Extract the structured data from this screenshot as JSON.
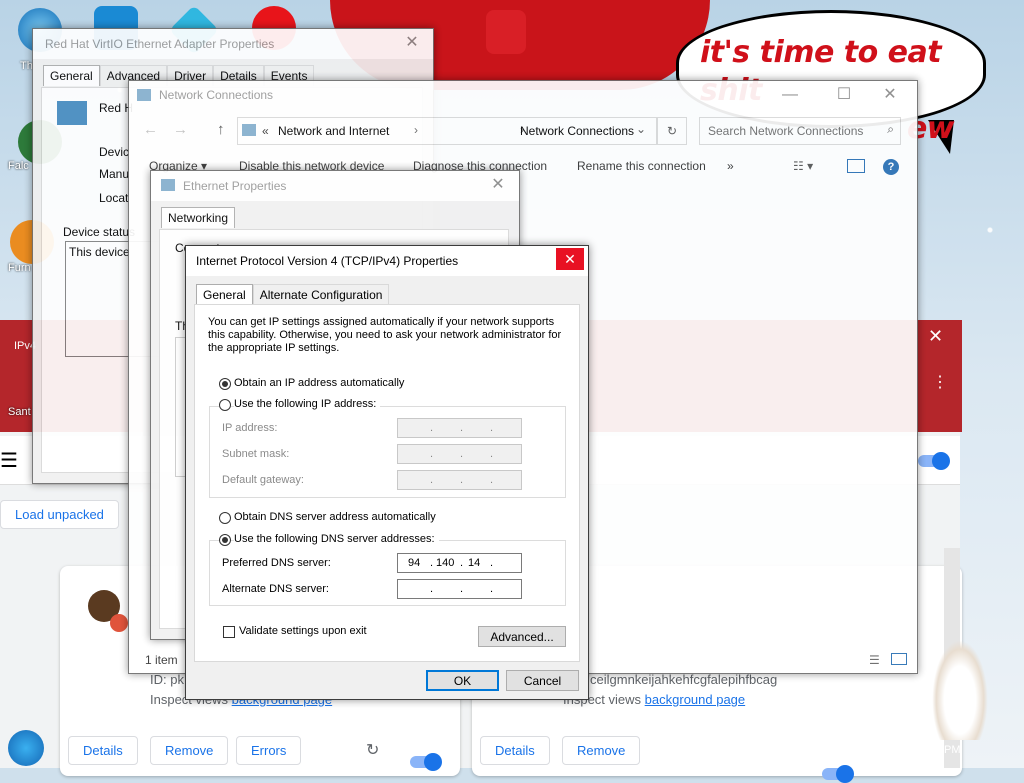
{
  "wallpaper": {
    "speech_line1": "it's time to eat shit",
    "speech_line2": "ew"
  },
  "desktop_icons": [
    {
      "label": "Th"
    },
    {
      "label": "Falc"
    },
    {
      "label": "Furn"
    },
    {
      "label": "Sant"
    }
  ],
  "extensions_page": {
    "load_unpacked": "Load unpacked",
    "id_prefix": "ID: pk",
    "id_right": "ceilgmnkeijahkehfcgfalepihfbcag",
    "inspect_left": "Inspect views",
    "inspect_left_link": "background page",
    "inspect_right": "Inspect views",
    "inspect_right_link": "background page",
    "details": "Details",
    "remove": "Remove",
    "errors": "Errors",
    "details2": "Details",
    "remove2": "Remove",
    "ipv4_fragment": "IPv4"
  },
  "adapter_window": {
    "title": "Red Hat VirtIO Ethernet Adapter Properties",
    "tabs": [
      "General",
      "Advanced",
      "Driver",
      "Details",
      "Events"
    ],
    "name_fragment": "Red H",
    "device_type_label": "Devic",
    "manufacturer_label": "Manu",
    "location_label": "Locat",
    "device_status_label": "Device status",
    "device_status_text": "This device"
  },
  "network_connections": {
    "title": "Network Connections",
    "breadcrumb": [
      "Network and Internet",
      "Network Connections"
    ],
    "breadcrumb_prefix": "«",
    "search_placeholder": "Search Network Connections",
    "toolbar": [
      "Organize ▾",
      "Disable this network device",
      "Diagnose this connection",
      "Rename this connection",
      "»"
    ],
    "status_items": "1 item"
  },
  "ethernet_properties": {
    "title": "Ethernet Properties",
    "tab": "Networking",
    "connect_fragment": "Connect",
    "th_fragment": "Th"
  },
  "ipv4_dialog": {
    "title": "Internet Protocol Version 4 (TCP/IPv4) Properties",
    "tabs": [
      "General",
      "Alternate Configuration"
    ],
    "description": "You can get IP settings assigned automatically if your network supports this capability. Otherwise, you need to ask your network administrator for the appropriate IP settings.",
    "radio_auto_ip": "Obtain an IP address automatically",
    "radio_manual_ip": "Use the following IP address:",
    "ip_address_label": "IP address:",
    "subnet_label": "Subnet mask:",
    "gateway_label": "Default gateway:",
    "radio_auto_dns": "Obtain DNS server address automatically",
    "radio_manual_dns": "Use the following DNS server addresses:",
    "preferred_dns_label": "Preferred DNS server:",
    "preferred_dns_octets": [
      "94",
      "140",
      "14",
      ""
    ],
    "alternate_dns_label": "Alternate DNS server:",
    "validate_label": "Validate settings upon exit",
    "advanced_button": "Advanced...",
    "ok_button": "OK",
    "cancel_button": "Cancel",
    "selected_ip_mode": "auto",
    "selected_dns_mode": "manual"
  },
  "taskbar": {
    "clock_fragment": "PM"
  }
}
